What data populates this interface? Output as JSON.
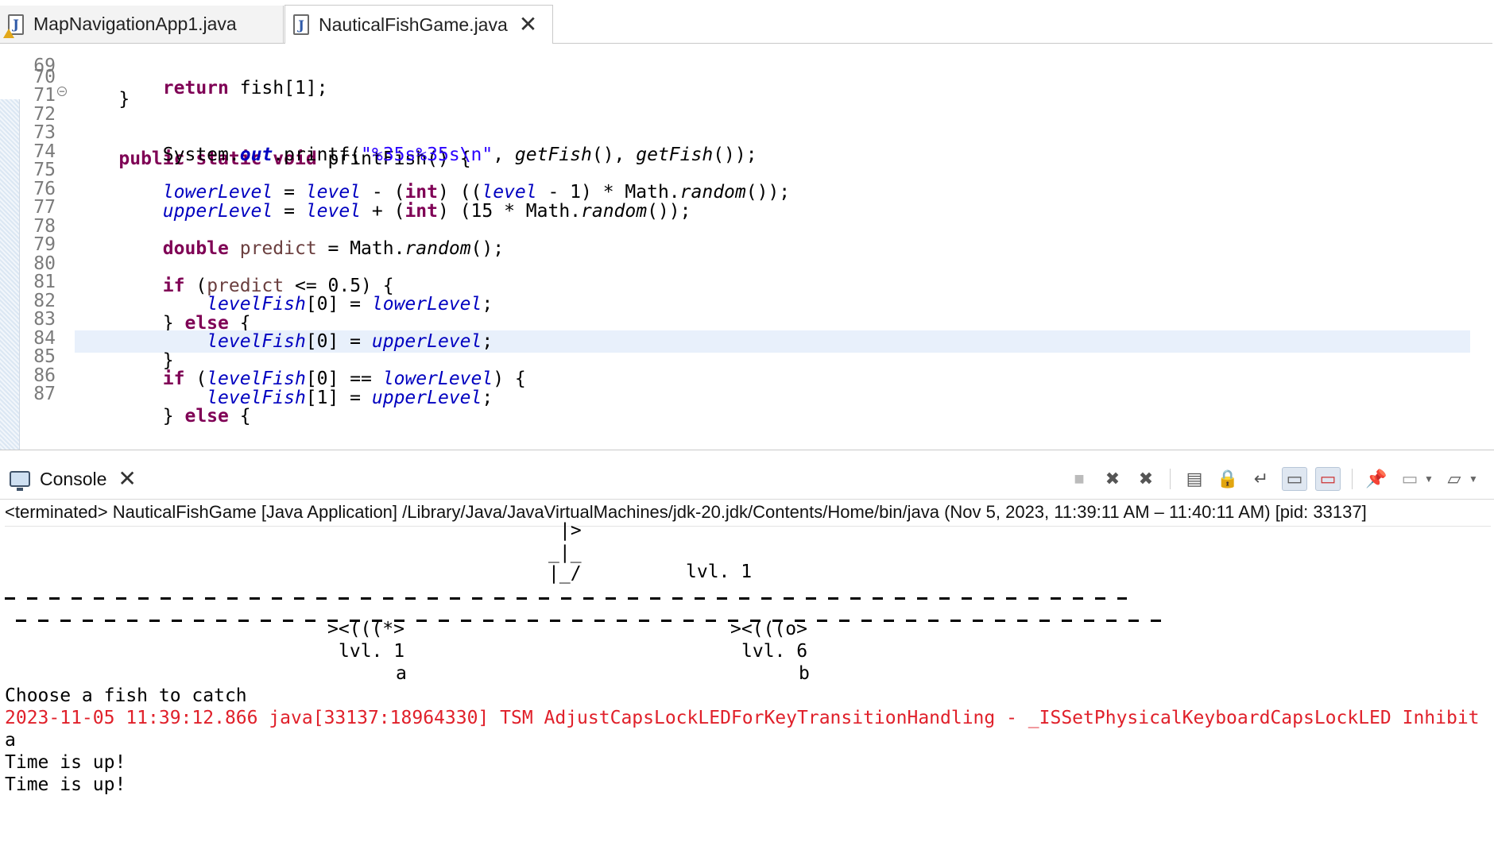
{
  "editor": {
    "tabs": [
      {
        "label": "MapNavigationApp1.java",
        "active": false,
        "warning": true
      },
      {
        "label": "NauticalFishGame.java",
        "active": true,
        "warning": false
      }
    ],
    "lines": [
      {
        "n": "69",
        "text": "        return fish[1];"
      },
      {
        "n": "70",
        "text": "    }"
      },
      {
        "n": "71",
        "text": ""
      },
      {
        "n": "72",
        "text": "    public static void printFish() {"
      },
      {
        "n": "73",
        "text": "        System.out.printf(\"%35s%35s\\n\", getFish(), getFish());"
      },
      {
        "n": "74",
        "text": ""
      },
      {
        "n": "75",
        "text": "        lowerLevel = level - (int) ((level - 1) * Math.random());"
      },
      {
        "n": "76",
        "text": "        upperLevel = level + (int) (15 * Math.random());"
      },
      {
        "n": "77",
        "text": ""
      },
      {
        "n": "78",
        "text": "        double predict = Math.random();"
      },
      {
        "n": "79",
        "text": ""
      },
      {
        "n": "80",
        "text": "        if (predict <= 0.5) {"
      },
      {
        "n": "81",
        "text": "            levelFish[0] = lowerLevel;"
      },
      {
        "n": "82",
        "text": "        } else {"
      },
      {
        "n": "83",
        "text": "            levelFish[0] = upperLevel;"
      },
      {
        "n": "84",
        "text": "        }"
      },
      {
        "n": "85",
        "text": "        if (levelFish[0] == lowerLevel) {"
      },
      {
        "n": "86",
        "text": "            levelFish[1] = upperLevel;"
      },
      {
        "n": "87",
        "text": "        } else {"
      }
    ]
  },
  "console": {
    "tab_label": "Console",
    "process_info": "<terminated> NauticalFishGame [Java Application] /Library/Java/JavaVirtualMachines/jdk-20.jdk/Contents/Home/bin/java  (Nov 5, 2023, 11:39:11 AM – 11:40:11 AM) [pid: 33137]",
    "boat": {
      "flag": "|>",
      "mast": "_|_",
      "hull": "|_/",
      "level": "lvl. 1"
    },
    "fish": [
      {
        "art": "><(((*>",
        "level": "lvl. 1",
        "key": "a"
      },
      {
        "art": "><(((o>",
        "level": "lvl. 6",
        "key": "b"
      }
    ],
    "prompt": "Choose a fish to catch",
    "error_line": "2023-11-05 11:39:12.866 java[33137:18964330] TSM AdjustCapsLockLEDForKeyTransitionHandling - _ISSetPhysicalKeyboardCapsLockLED Inhibit",
    "input_echo": "a",
    "messages": [
      "Time is up!",
      "Time is up!"
    ],
    "colors": {
      "error": "#e0202a"
    }
  }
}
